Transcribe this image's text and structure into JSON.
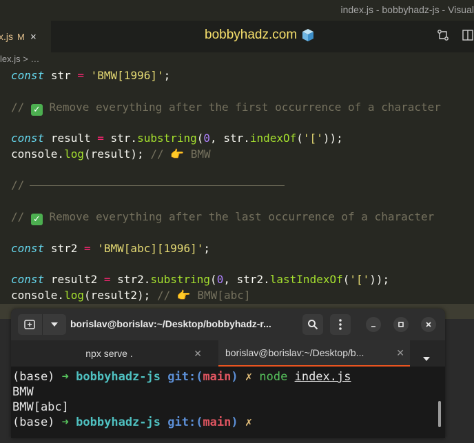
{
  "window": {
    "title": "index.js - bobbyhadz-js - Visual"
  },
  "tab": {
    "name": "x.js",
    "modified": "M",
    "close": "×"
  },
  "header": {
    "site": "bobbyhadz.com"
  },
  "breadcrumb": {
    "text": "lex.js > …"
  },
  "code": {
    "l1": {
      "kw": "const",
      "name": "str",
      "op": "=",
      "val": "'BMW[1996]'",
      "end": ";"
    },
    "l2": {
      "prefix": "//",
      "text": "Remove everything after the first occurrence of a character"
    },
    "l3": {
      "kw": "const",
      "name": "result",
      "op": "=",
      "obj": "str.",
      "fn": "substring",
      "open": "(",
      "num": "0",
      "mid": ", str.",
      "fn2": "indexOf",
      "arg": "'['",
      "close": "));"
    },
    "l4": {
      "obj": "console.",
      "fn": "log",
      "arg": "(result);",
      "comment": "//",
      "out": "BMW"
    },
    "l5": {
      "prefix": "//"
    },
    "l6": {
      "prefix": "//",
      "text": "Remove everything after the last occurrence of a character"
    },
    "l7": {
      "kw": "const",
      "name": "str2",
      "op": "=",
      "val": "'BMW[abc][1996]'",
      "end": ";"
    },
    "l8": {
      "kw": "const",
      "name": "result2",
      "op": "=",
      "obj": "str2.",
      "fn": "substring",
      "open": "(",
      "num": "0",
      "mid": ", str2.",
      "fn2": "lastIndexOf",
      "arg": "'['",
      "close": "));"
    },
    "l9": {
      "obj": "console.",
      "fn": "log",
      "arg": "(result2);",
      "comment": "//",
      "out": "BMW[abc]"
    }
  },
  "terminal": {
    "title": "borislav@borislav:~/Desktop/bobbyhadz-r...",
    "tabs": [
      {
        "label": "npx serve ."
      },
      {
        "label": "borislav@borislav:~/Desktop/b..."
      }
    ],
    "lines": {
      "p1": {
        "base": "(base)",
        "arrow": "➜",
        "dir": "bobbyhadz-js",
        "git": "git:(",
        "branch": "main",
        "gclose": ")",
        "x": "✗",
        "cmd": "node",
        "file": "index.js"
      },
      "o1": "BMW",
      "o2": "BMW[abc]",
      "p2": {
        "base": "(base)",
        "arrow": "➜",
        "dir": "bobbyhadz-js",
        "git": "git:(",
        "branch": "main",
        "gclose": ")",
        "x": "✗"
      }
    }
  },
  "colors": {
    "accent": "#e95420",
    "title": "#f8e16c"
  }
}
